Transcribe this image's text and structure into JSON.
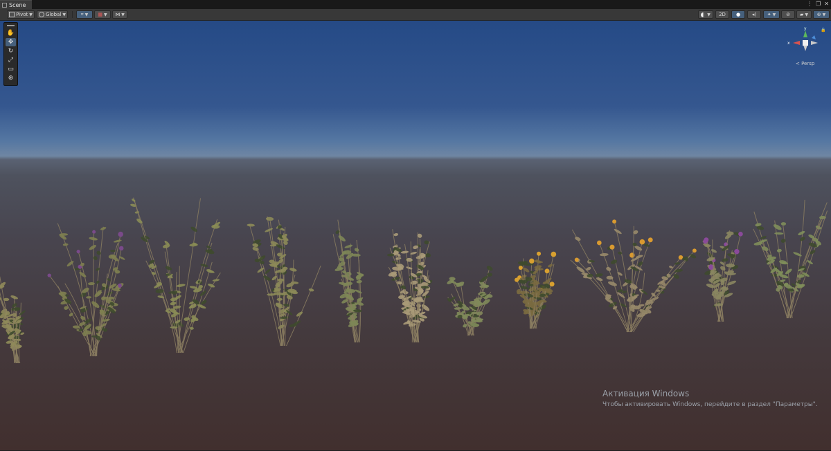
{
  "tab": {
    "label": "Scene",
    "icon": "hash-icon"
  },
  "window_controls": {
    "menu": "⋮",
    "maximize": "❐",
    "close": "✕"
  },
  "toolbar": {
    "pivot_label": "Pivot",
    "global_label": "Global",
    "mode_2d_label": "2D"
  },
  "tools": {
    "items": [
      "hand-tool",
      "move-tool",
      "rotate-tool",
      "scale-tool",
      "rect-tool",
      "transform-tool"
    ],
    "active": "move-tool"
  },
  "gizmo": {
    "y_label": "y",
    "x_label": "x",
    "projection_label": "< Persp"
  },
  "watermark": {
    "title": "Активация Windows",
    "subtitle": "Чтобы активировать Windows, перейдите в раздел \"Параметры\"."
  },
  "colors": {
    "sky_top": "#254a86",
    "horizon": "#6f86a3",
    "ground": "#412f2e",
    "gizmo_x": "#d9534f",
    "gizmo_y": "#5cb85c",
    "gizmo_z": "#4d8ed8",
    "accent": "#46607c"
  }
}
